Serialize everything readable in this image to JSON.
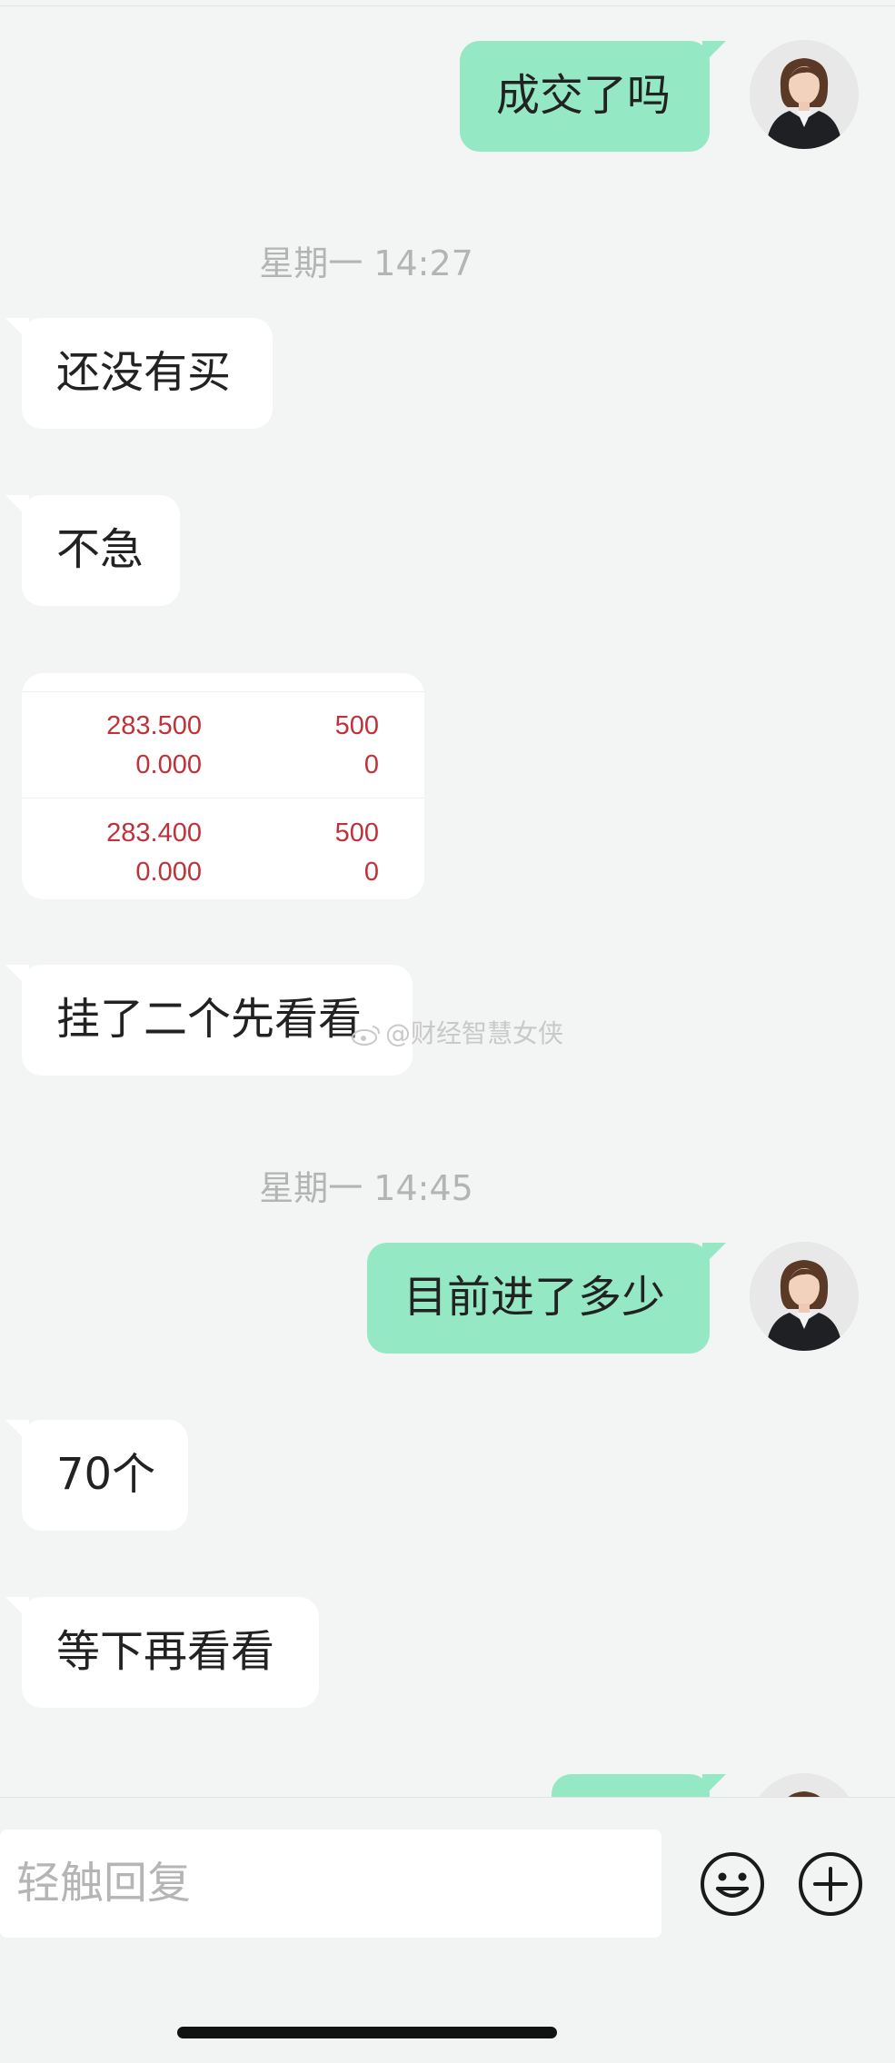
{
  "messages": [
    {
      "type": "outgoing",
      "text": "成交了吗"
    },
    {
      "type": "timestamp",
      "text": "星期一 14:27"
    },
    {
      "type": "incoming",
      "text": "还没有买"
    },
    {
      "type": "incoming",
      "text": "不急"
    },
    {
      "type": "incoming",
      "text": "挂了二个先看看"
    },
    {
      "type": "timestamp",
      "text": "星期一 14:45"
    },
    {
      "type": "outgoing",
      "text": "目前进了多少"
    },
    {
      "type": "incoming",
      "text": "70个"
    },
    {
      "type": "incoming",
      "text": "等下再看看"
    }
  ],
  "quote_card": {
    "rows": [
      {
        "price": "283.500",
        "qty": "500",
        "price2": "0.000",
        "qty2": "0"
      },
      {
        "price": "283.400",
        "qty": "500",
        "price2": "0.000",
        "qty2": "0"
      }
    ]
  },
  "watermark": "@财经智慧女侠",
  "input": {
    "placeholder": "轻触回复"
  },
  "icons": {
    "emoji": "emoji-icon",
    "add": "plus-circle-icon",
    "avatar": "user-avatar"
  },
  "colors": {
    "outgoing_bubble": "#95e8c4",
    "incoming_bubble": "#ffffff",
    "background": "#f3f4f4",
    "quote_red": "#c0323a",
    "timestamp": "#b4b4b4"
  }
}
